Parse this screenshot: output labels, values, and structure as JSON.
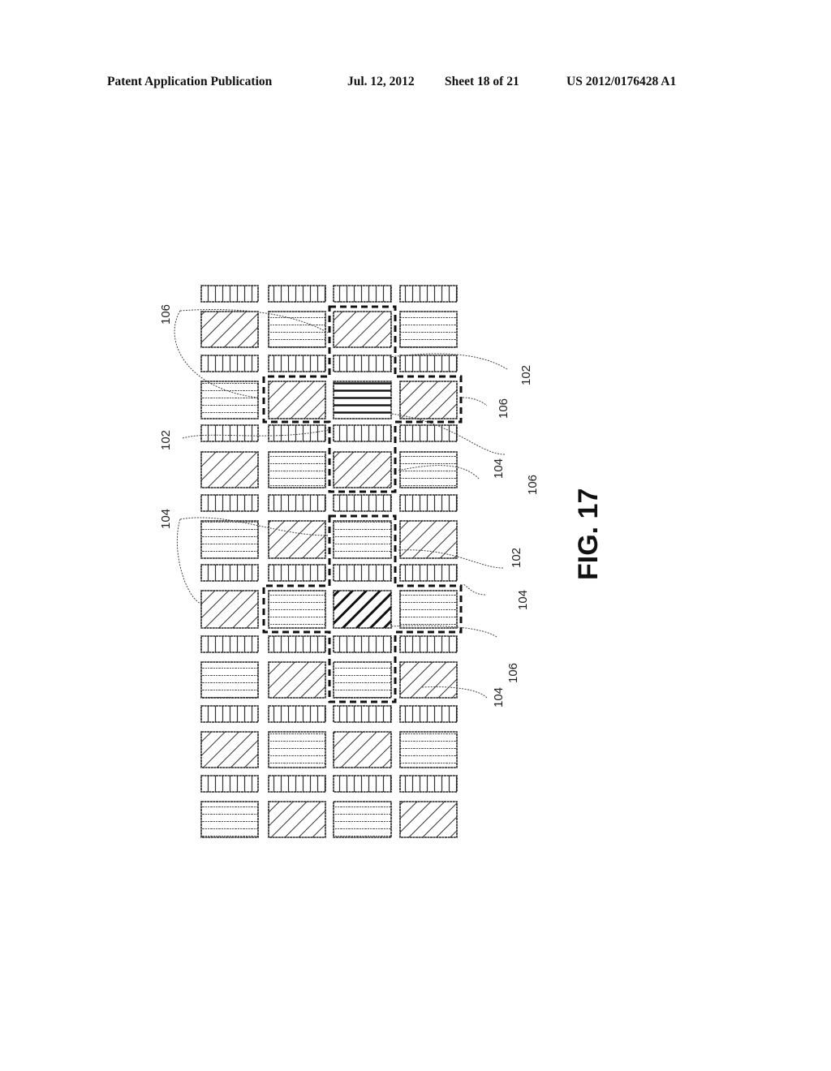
{
  "header": {
    "publication": "Patent Application Publication",
    "date": "Jul. 12, 2012",
    "sheet": "Sheet 18 of 21",
    "number": "US 2012/0176428 A1"
  },
  "figure": {
    "label": "FIG. 17",
    "columns": 4,
    "strip_rows": 8,
    "cell_rows": [
      [
        "diagonal",
        "horizontal",
        "diagonal",
        "horizontal"
      ],
      [
        "horizontal",
        "diagonal",
        "horizontal-bold",
        "diagonal"
      ],
      [
        "diagonal",
        "horizontal",
        "diagonal",
        "horizontal"
      ],
      [
        "horizontal",
        "diagonal",
        "horizontal",
        "diagonal"
      ],
      [
        "diagonal",
        "horizontal",
        "diagonal-bold",
        "horizontal"
      ],
      [
        "horizontal",
        "diagonal",
        "horizontal",
        "diagonal"
      ],
      [
        "diagonal",
        "horizontal",
        "diagonal",
        "horizontal"
      ],
      [
        "horizontal",
        "diagonal",
        "horizontal",
        "diagonal"
      ]
    ],
    "reference_labels": [
      {
        "id": "ref-106-a",
        "text": "106"
      },
      {
        "id": "ref-102-a",
        "text": "102"
      },
      {
        "id": "ref-104-a",
        "text": "104"
      },
      {
        "id": "ref-102-b",
        "text": "102"
      },
      {
        "id": "ref-106-b",
        "text": "106"
      },
      {
        "id": "ref-104-b",
        "text": "104"
      },
      {
        "id": "ref-106-c",
        "text": "106"
      },
      {
        "id": "ref-102-c",
        "text": "102"
      },
      {
        "id": "ref-104-c",
        "text": "104"
      },
      {
        "id": "ref-106-d",
        "text": "106"
      },
      {
        "id": "ref-104-d",
        "text": "104"
      }
    ]
  }
}
